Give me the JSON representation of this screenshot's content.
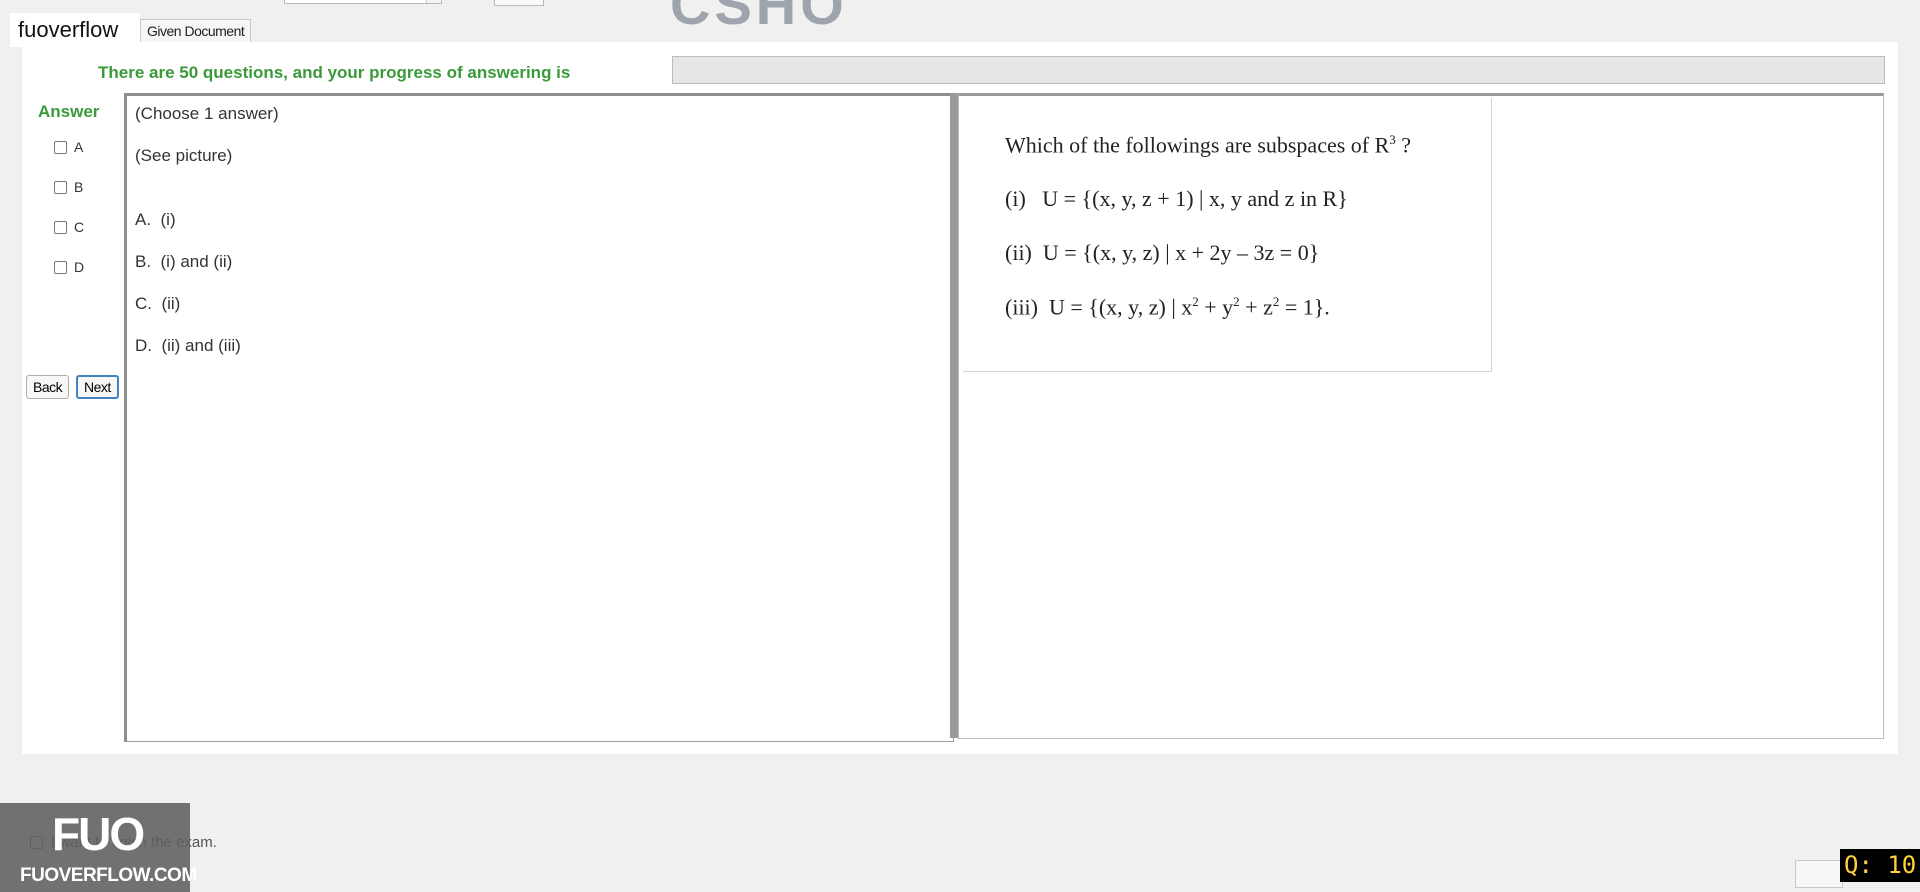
{
  "app": {
    "brand": "fuoverflow",
    "tab": "Given Document"
  },
  "progress": {
    "label": "There are 50 questions, and your progress of answering is",
    "value": 0
  },
  "answer": {
    "heading": "Answer",
    "options": [
      "A",
      "B",
      "C",
      "D"
    ]
  },
  "navigation": {
    "back": "Back",
    "next": "Next"
  },
  "question": {
    "instruction": "(Choose 1 answer)",
    "note": "(See picture)",
    "choices": [
      {
        "letter": "A.",
        "text": "(i)"
      },
      {
        "letter": "B.",
        "text": "(i) and (ii)"
      },
      {
        "letter": "C.",
        "text": "(ii)"
      },
      {
        "letter": "D.",
        "text": "(ii) and (iii)"
      }
    ]
  },
  "picture": {
    "prompt": "Which of the followings are subspaces of R",
    "prompt_sup": "3",
    "prompt_end": "?",
    "items": [
      {
        "num": "(i)",
        "text": "U = {(x, y, z + 1) | x, y and z in R}"
      },
      {
        "num": "(ii)",
        "text": "U = {(x, y, z)  |  x + 2y – 3z = 0}"
      },
      {
        "num": "(iii)",
        "text_a": "U = {(x, y, z) | x",
        "sup1": "2",
        "text_b": " + y",
        "sup2": "2",
        "text_c": " + z",
        "sup3": "2",
        "text_d": " = 1}."
      }
    ]
  },
  "footer": {
    "finish_label": "I want to finish the exam.",
    "counter": "Q: 10",
    "watermark_logo": "FUO",
    "watermark_text": "FUOVERFLOW.COM"
  }
}
